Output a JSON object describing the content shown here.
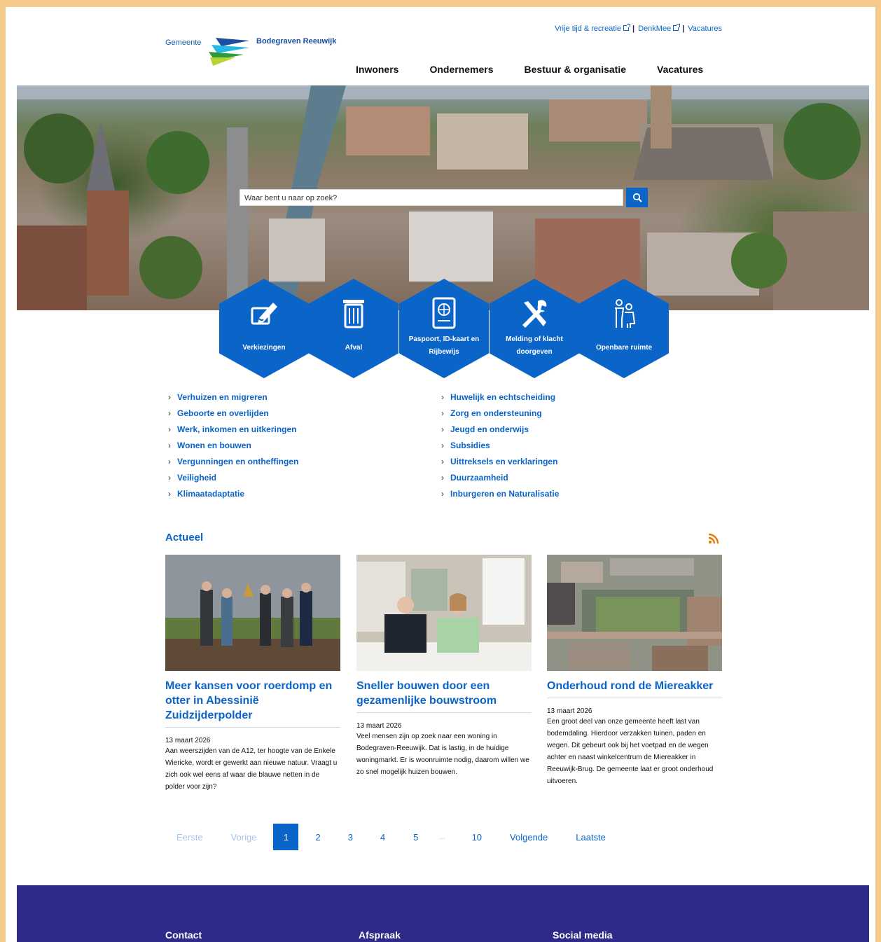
{
  "header": {
    "logo_pre": "Gemeente",
    "logo_name": "Bodegraven Reeuwijk",
    "toplinks": [
      "Vrije tijd & recreatie",
      "DenkMee",
      "Vacatures"
    ],
    "nav": [
      "Inwoners",
      "Ondernemers",
      "Bestuur & organisatie",
      "Vacatures"
    ]
  },
  "search": {
    "placeholder": "Waar bent u naar op zoek?"
  },
  "tiles": [
    {
      "label": "Verkiezingen",
      "icon": "ballot-pen-icon"
    },
    {
      "label": "Afval",
      "icon": "trash-bin-icon"
    },
    {
      "label": "Paspoort, ID-kaart en Rijbewijs",
      "icon": "passport-icon"
    },
    {
      "label": "Melding of klacht doorgeven",
      "icon": "tools-icon"
    },
    {
      "label": "Openbare ruimte",
      "icon": "people-icon"
    }
  ],
  "links_left": [
    "Verhuizen en migreren",
    "Geboorte en overlijden",
    "Werk, inkomen en uitkeringen",
    "Wonen en bouwen",
    "Vergunningen en ontheffingen",
    "Veiligheid",
    "Klimaatadaptatie"
  ],
  "links_right": [
    "Huwelijk en echtscheiding",
    "Zorg en ondersteuning",
    "Jeugd en onderwijs",
    "Subsidies",
    "Uittreksels en verklaringen",
    "Duurzaamheid",
    "Inburgeren en Naturalisatie"
  ],
  "news": {
    "title": "Actueel",
    "items": [
      {
        "title": "Meer kansen voor roerdomp en otter in Abessinië Zuidzijderpolder",
        "date": "13 maart 2026",
        "text": "Aan weerszijden van de A12, ter hoogte van de Enkele Wiericke, wordt er gewerkt aan nieuwe natuur. Vraagt u zich ook wel eens af waar die blauwe netten in de polder voor zijn?"
      },
      {
        "title": "Sneller bouwen door een gezamenlijke bouwstroom",
        "date": "13 maart 2026",
        "text": "Veel mensen zijn op zoek naar een woning in Bodegraven-Reeuwijk. Dat is lastig, in de huidige woningmarkt. Er is woonruimte nodig, daarom willen we zo snel mogelijk huizen bouwen."
      },
      {
        "title": "Onderhoud rond de Miereakker",
        "date": "13 maart 2026",
        "text": "Een groot deel van onze gemeente heeft last van bodemdaling. Hierdoor verzakken tuinen, paden en wegen. Dit gebeurt ook bij het voetpad en de wegen achter en naast winkelcentrum de Miereakker in Reeuwijk-Brug. De gemeente laat er groot onderhoud uitvoeren."
      }
    ]
  },
  "pager": {
    "first": "Eerste",
    "prev": "Vorige",
    "pages": [
      "1",
      "2",
      "3",
      "4",
      "5"
    ],
    "dots": "...",
    "last_page": "10",
    "next": "Volgende",
    "last": "Laatste",
    "current": 1
  },
  "footer": {
    "cols": [
      "Contact",
      "Afspraak",
      "Social media"
    ]
  },
  "colors": {
    "brand_blue": "#0b64c8",
    "footer": "#2d2a8a",
    "frame": "#f5c98a",
    "rss": "#e07b00"
  }
}
